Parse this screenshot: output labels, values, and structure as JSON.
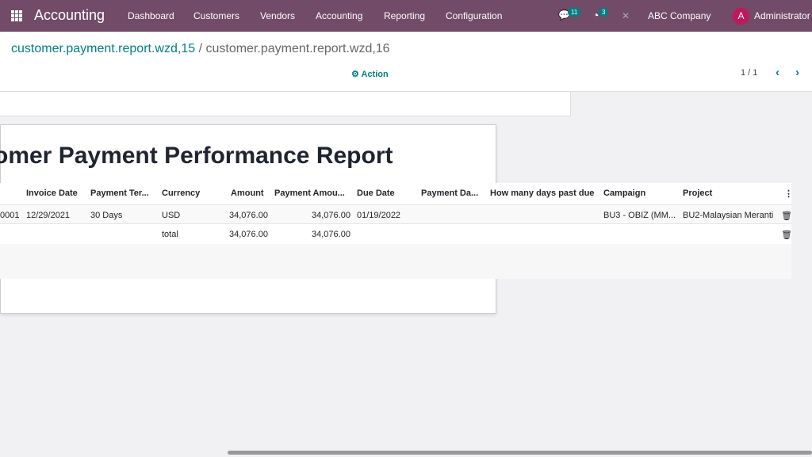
{
  "nav": {
    "app": "Accounting",
    "menus": [
      "Dashboard",
      "Customers",
      "Vendors",
      "Accounting",
      "Reporting",
      "Configuration"
    ],
    "messages_count": "11",
    "activities_count": "3",
    "company": "ABC Company",
    "avatar_letter": "A",
    "user": "Administrator",
    "brand_color": "#714B67"
  },
  "breadcrumb": {
    "parent": "customer.payment.report.wzd,15",
    "separator": "/",
    "current": "customer.payment.report.wzd,16"
  },
  "toolbar": {
    "action": "Action",
    "pager": "1 / 1"
  },
  "report": {
    "title": "omer Payment Performance Report",
    "columns": [
      "Invoice Date",
      "Payment Ter...",
      "Currency",
      "Amount",
      "Payment Amou...",
      "Due Date",
      "Payment Da...",
      "How many days past due",
      "Campaign",
      "Project"
    ],
    "rows": [
      {
        "number": "0001",
        "invoice_date": "12/29/2021",
        "payment_terms": "30 Days",
        "currency": "USD",
        "amount": "34,076.00",
        "payment_amount": "34,076.00",
        "due_date": "01/19/2022",
        "campaign": "BU3 - OBIZ (MM...",
        "project": "BU2-Malaysian Meranti"
      }
    ],
    "total": {
      "label": "total",
      "amount": "34,076.00",
      "payment_amount": "34,076.00"
    }
  }
}
